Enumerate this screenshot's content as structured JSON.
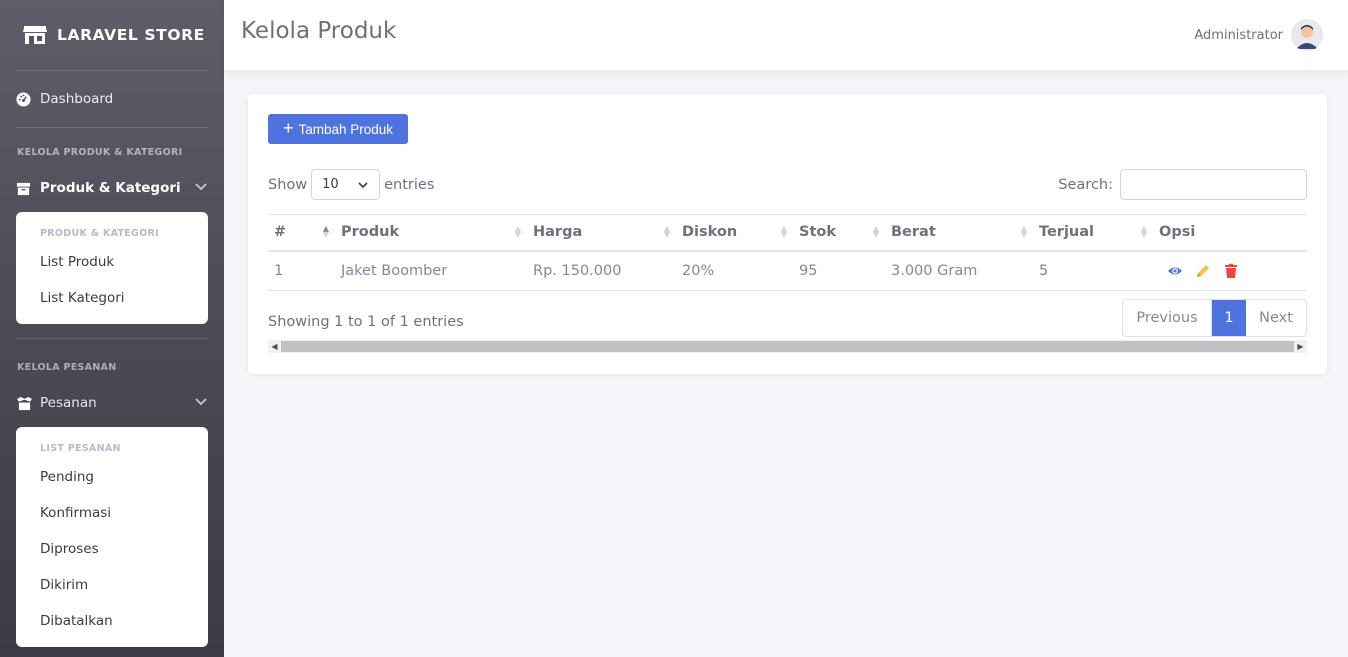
{
  "brand": {
    "name": "LARAVEL STORE"
  },
  "sidebar": {
    "dashboard": "Dashboard",
    "section1": "KELOLA PRODUK & KATEGORI",
    "produk_kategori": "Produk & Kategori",
    "submenu1": {
      "heading": "PRODUK & KATEGORI",
      "items": [
        "List Produk",
        "List Kategori"
      ]
    },
    "section2": "KELOLA PESANAN",
    "pesanan": "Pesanan",
    "submenu2": {
      "heading": "LIST PESANAN",
      "items": [
        "Pending",
        "Konfirmasi",
        "Diproses",
        "Dikirim",
        "Dibatalkan"
      ]
    }
  },
  "topbar": {
    "title": "Kelola Produk",
    "user": "Administrator"
  },
  "content": {
    "add_button": "Tambah Produk",
    "show_label": "Show",
    "entries_value": "10",
    "entries_label": "entries",
    "search_label": "Search:",
    "search_value": "",
    "columns": [
      "#",
      "Produk",
      "Harga",
      "Diskon",
      "Stok",
      "Berat",
      "Terjual",
      "Opsi"
    ],
    "rows": [
      [
        "1",
        "Jaket Boomber",
        "Rp. 150.000",
        "20%",
        "95",
        "3.000 Gram",
        "5"
      ]
    ],
    "info": "Showing 1 to 1 of 1 entries",
    "pagination": {
      "previous": "Previous",
      "current": "1",
      "next": "Next"
    }
  },
  "colors": {
    "primary": "#4e73df",
    "view_icon": "#4e73df",
    "edit_icon": "#f6c23e",
    "delete_icon": "#e74a3b"
  }
}
